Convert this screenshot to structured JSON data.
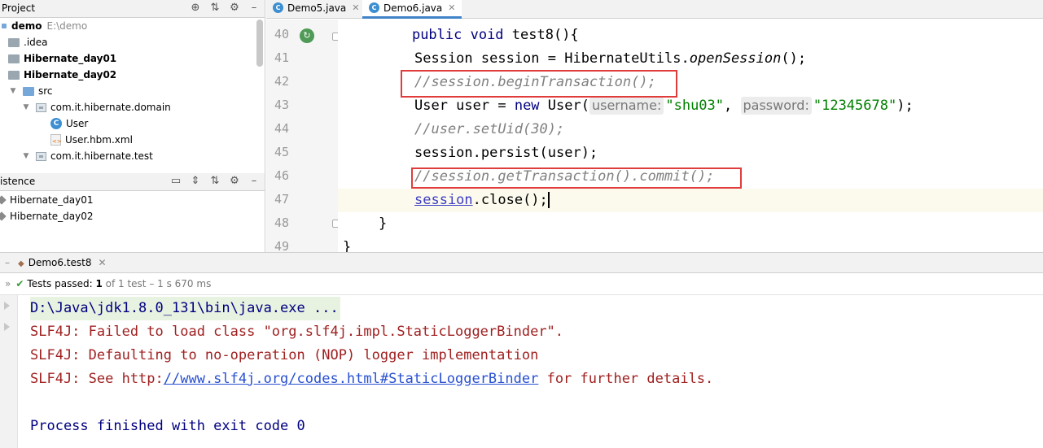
{
  "project_panel": {
    "title": "Project",
    "tree": [
      {
        "label": "demo",
        "path": "E:\\demo",
        "kind": "project",
        "bold": true,
        "depth": 0
      },
      {
        "label": ".idea",
        "kind": "folder",
        "depth": 1
      },
      {
        "label": "Hibernate_day01",
        "kind": "module",
        "bold": true,
        "depth": 1
      },
      {
        "label": "Hibernate_day02",
        "kind": "module",
        "bold": true,
        "depth": 1
      },
      {
        "label": "src",
        "kind": "source-folder",
        "expanded": true,
        "depth": 2
      },
      {
        "label": "com.it.hibernate.domain",
        "kind": "package",
        "expanded": true,
        "depth": 3
      },
      {
        "label": "User",
        "kind": "class",
        "depth": 4
      },
      {
        "label": "User.hbm.xml",
        "kind": "xml",
        "depth": 4
      },
      {
        "label": "com.it.hibernate.test",
        "kind": "package",
        "expanded": true,
        "depth": 3
      }
    ]
  },
  "persistence_panel": {
    "title": "istence",
    "items": [
      "Hibernate_day01",
      "Hibernate_day02"
    ]
  },
  "editor": {
    "tabs": [
      {
        "label": "Demo5.java",
        "active": false
      },
      {
        "label": "Demo6.java",
        "active": true
      }
    ],
    "line_numbers": [
      "40",
      "41",
      "42",
      "43",
      "44",
      "45",
      "46",
      "47",
      "48",
      "49"
    ],
    "current_line": "47",
    "code": {
      "l40": {
        "kw": "public void",
        "rest": " test8(){"
      },
      "l41": {
        "a": "Session session = HibernateUtils.",
        "b": "openSession",
        "c": "();"
      },
      "l42": {
        "comment": "//session.beginTransaction();"
      },
      "l43": {
        "a": "User user = ",
        "kw": "new",
        "b": " User(",
        "hint1": "username:",
        "s1": "\"shu03\"",
        "c": ", ",
        "hint2": "password:",
        "s2": "\"12345678\"",
        "d": ");"
      },
      "l44": {
        "comment": "//user.setUid(30);"
      },
      "l45": {
        "text": "session.persist(user);"
      },
      "l46": {
        "comment": "//session.getTransaction().commit();"
      },
      "l47": {
        "var": "session",
        "rest": ".close();"
      },
      "l48": {
        "text": "}"
      },
      "l49": {
        "text": "}"
      }
    }
  },
  "run_panel": {
    "tab_label": "Demo6.test8",
    "tests_passed_label": "Tests passed:",
    "tests_passed_count": "1",
    "tests_summary": "of 1 test – 1 s 670 ms",
    "console": {
      "command": "D:\\Java\\jdk1.8.0_131\\bin\\java.exe ...",
      "err1": "SLF4J: Failed to load class \"org.slf4j.impl.StaticLoggerBinder\".",
      "err2": "SLF4J: Defaulting to no-operation (NOP) logger implementation",
      "err3_prefix": "SLF4J: See http:",
      "err3_link": "//www.slf4j.org/codes.html#StaticLoggerBinder",
      "err3_suffix": " for further details.",
      "exit": "Process finished with exit code 0"
    }
  },
  "colors": {
    "keyword": "#000080",
    "string": "#008000",
    "comment": "#808080",
    "error_text": "#a02020",
    "highlight_box": "#e03c3c",
    "tests_passed": "#3a9b3a"
  }
}
